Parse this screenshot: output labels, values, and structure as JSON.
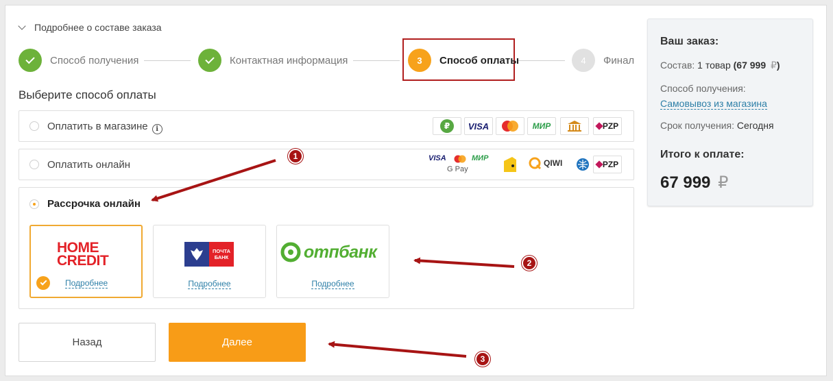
{
  "header": {
    "details_toggle": "Подробнее о составе заказа"
  },
  "steps": [
    {
      "num": "",
      "label": "Способ получения",
      "state": "done"
    },
    {
      "num": "",
      "label": "Контактная информация",
      "state": "done"
    },
    {
      "num": "3",
      "label": "Способ оплаты",
      "state": "active"
    },
    {
      "num": "4",
      "label": "Финал",
      "state": "todo"
    }
  ],
  "payment": {
    "title": "Выберите способ оплаты",
    "options": [
      {
        "label": "Оплатить в магазине",
        "info": "i"
      },
      {
        "label": "Оплатить онлайн"
      },
      {
        "label": "Рассрочка онлайн"
      }
    ],
    "store_icons": [
      "₽",
      "VISA",
      "MasterCard",
      "МИР",
      "bank-icon",
      "PZP"
    ],
    "online_icons": {
      "visa": "VISA",
      "mir": "МИР",
      "gpay": "G Pay",
      "qiwi": "QIWI",
      "pzp": "PZP"
    },
    "banks": [
      {
        "name_line1": "HOME",
        "name_line2": "CREDIT",
        "more": "Подробнее",
        "selected": true
      },
      {
        "name_line1": "ПОЧТА",
        "name_line2": "БАНК",
        "more": "Подробнее",
        "selected": false
      },
      {
        "name": "отпбанк",
        "more": "Подробнее",
        "selected": false
      }
    ]
  },
  "buttons": {
    "back": "Назад",
    "next": "Далее"
  },
  "summary": {
    "title": "Ваш заказ:",
    "composition_label": "Состав:",
    "composition_value": "1 товар",
    "composition_price": "(67 999",
    "composition_currency": "₽",
    "composition_close": ")",
    "delivery_label": "Способ получения:",
    "delivery_value": "Самовывоз из магазина",
    "term_label": "Срок получения:",
    "term_value": "Сегодня",
    "total_label": "Итого к оплате:",
    "total_value": "67 999",
    "total_currency": "₽"
  },
  "annotations": [
    "1",
    "2",
    "3"
  ],
  "colors": {
    "accent": "#f89c17",
    "done": "#6db23a",
    "link": "#2d7fa7",
    "annotation": "#a71414"
  }
}
